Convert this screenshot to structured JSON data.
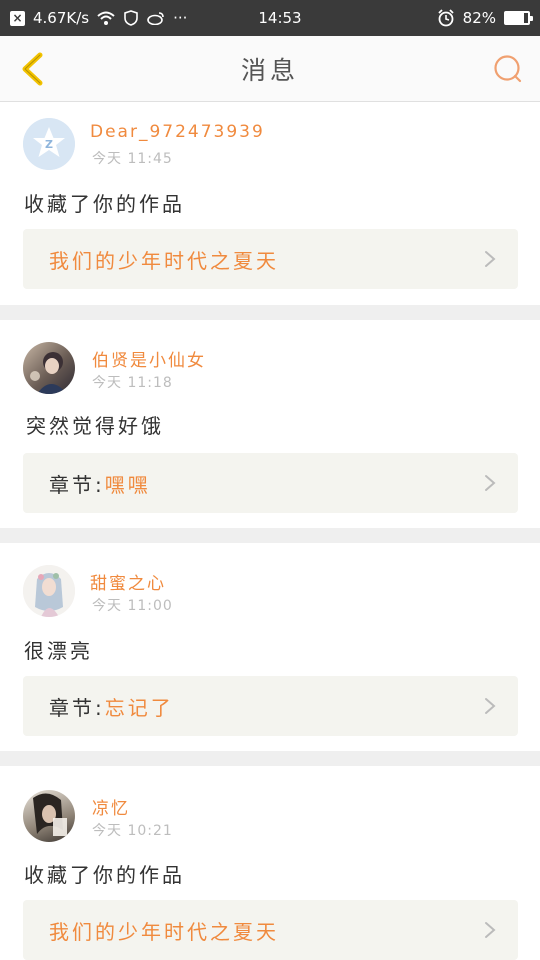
{
  "status_bar": {
    "net_speed": "4.67K/s",
    "time": "14:53",
    "battery": "82%",
    "battery_level": 0.82
  },
  "header": {
    "title": "消息"
  },
  "messages": [
    {
      "username": "Dear_972473939",
      "time": "今天 11:45",
      "text": "收藏了你的作品",
      "ref_prefix": "",
      "ref_title": "我们的少年时代之夏天"
    },
    {
      "username": "伯贤是小仙女",
      "time": "今天 11:18",
      "text": "突然觉得好饿",
      "ref_prefix": "章节:",
      "ref_title": "嘿嘿"
    },
    {
      "username": "甜蜜之心",
      "time": "今天 11:00",
      "text": "很漂亮",
      "ref_prefix": "章节:",
      "ref_title": "忘记了"
    },
    {
      "username": "凉忆",
      "time": "今天 10:21",
      "text": "收藏了你的作品",
      "ref_prefix": "",
      "ref_title": "我们的少年时代之夏天"
    }
  ],
  "colors": {
    "accent": "#f08a3e",
    "back_arrow": "#f2c200",
    "status_bar_bg": "#3a3a3a"
  }
}
